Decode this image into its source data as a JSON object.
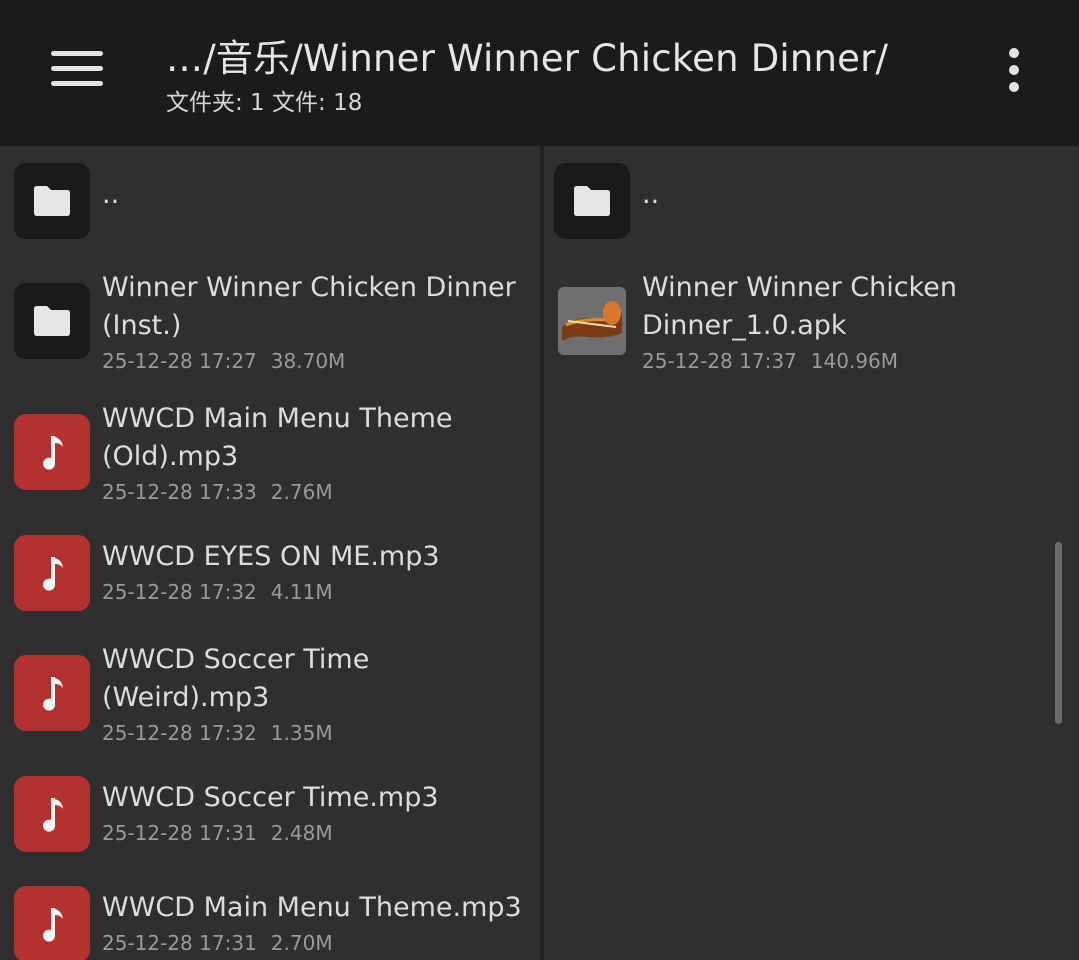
{
  "header": {
    "path": "…/音乐/Winner Winner Chicken Dinner/",
    "counts": "文件夹: 1  文件: 18",
    "icons": {
      "menu": "hamburger-menu-icon",
      "more": "more-vertical-icon"
    }
  },
  "left_pane": {
    "parent": {
      "name": ".."
    },
    "items": [
      {
        "type": "folder",
        "name_line1": "Winner Winner Chicken Dinner",
        "name_line2": "(Inst.)",
        "date": "25-12-28 17:27",
        "size": "38.70M"
      },
      {
        "type": "audio",
        "name_line1": "WWCD Main Menu Theme",
        "name_line2": "(Old).mp3",
        "date": "25-12-28 17:33",
        "size": "2.76M"
      },
      {
        "type": "audio",
        "name_line1": "WWCD EYES ON ME.mp3",
        "name_line2": "",
        "date": "25-12-28 17:32",
        "size": "4.11M"
      },
      {
        "type": "audio",
        "name_line1": "WWCD Soccer Time",
        "name_line2": "(Weird).mp3",
        "date": "25-12-28 17:32",
        "size": "1.35M"
      },
      {
        "type": "audio",
        "name_line1": "WWCD Soccer Time.mp3",
        "name_line2": "",
        "date": "25-12-28 17:31",
        "size": "2.48M"
      },
      {
        "type": "audio",
        "name_line1": "WWCD Main Menu Theme.mp3",
        "name_line2": "",
        "date": "25-12-28 17:31",
        "size": "2.70M"
      }
    ]
  },
  "right_pane": {
    "parent": {
      "name": ".."
    },
    "items": [
      {
        "type": "apk",
        "name_line1": "Winner Winner Chicken",
        "name_line2": "Dinner_1.0.apk",
        "date": "25-12-28 17:37",
        "size": "140.96M"
      }
    ]
  },
  "colors": {
    "topbar": "#1b1b1b",
    "background": "#2f2f2f",
    "folder_icon_bg": "#1a1a1a",
    "audio_icon_bg": "#b3322f",
    "primary_text": "#dcdcdc",
    "secondary_text": "#9a9a9a"
  }
}
